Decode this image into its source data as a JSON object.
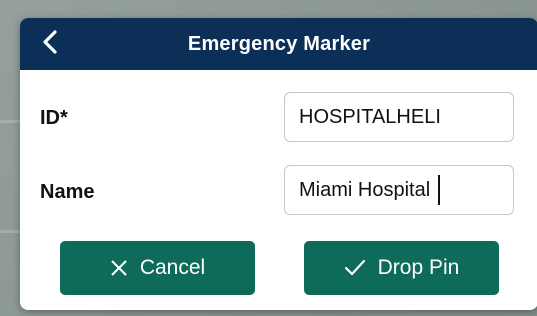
{
  "dialog": {
    "title": "Emergency Marker",
    "back_icon": "chevron-left-icon"
  },
  "fields": {
    "id": {
      "label": "ID*",
      "value": "HOSPITALHELI"
    },
    "name": {
      "label": "Name",
      "value": "Miami Hospital"
    }
  },
  "buttons": {
    "cancel": {
      "label": "Cancel",
      "icon": "close-icon"
    },
    "drop_pin": {
      "label": "Drop Pin",
      "icon": "check-icon"
    }
  },
  "colors": {
    "header": "#0b2f57",
    "button": "#0e6b5a"
  }
}
